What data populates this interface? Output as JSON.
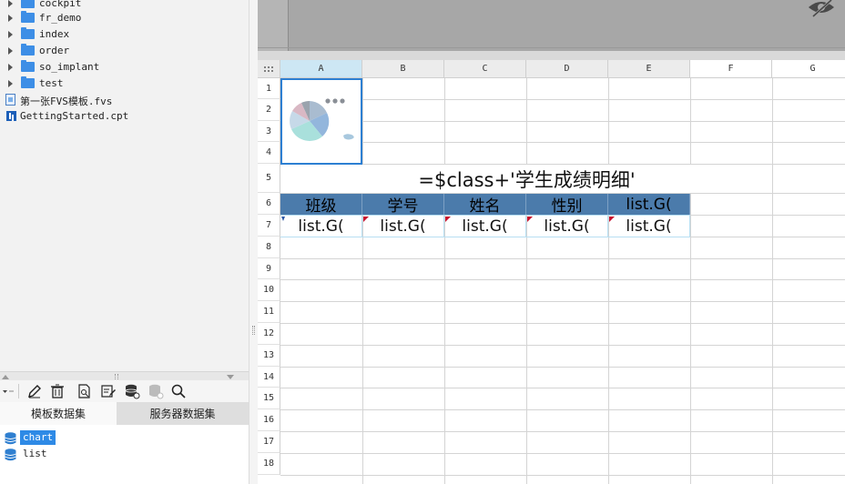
{
  "file_tree": {
    "folders": [
      {
        "name": "cockpit"
      },
      {
        "name": "fr_demo"
      },
      {
        "name": "index"
      },
      {
        "name": "order"
      },
      {
        "name": "so_implant"
      },
      {
        "name": "test"
      }
    ],
    "files": [
      {
        "name": "第一张FVS模板.fvs",
        "icon": "fvs-file-icon"
      },
      {
        "name": "GettingStarted.cpt",
        "icon": "cpt-file-icon"
      }
    ]
  },
  "dataset_toolbar": {
    "icons": [
      "dropdown-arrow-icon",
      "edit-icon",
      "delete-icon",
      "preview-icon",
      "edit-dataset-icon",
      "database-icon",
      "database-disabled-icon",
      "search-icon"
    ]
  },
  "dataset_tabs": {
    "template": "模板数据集",
    "server": "服务器数据集",
    "active": "template"
  },
  "datasets": [
    {
      "name": "chart",
      "selected": true
    },
    {
      "name": "list",
      "selected": false
    }
  ],
  "sheet": {
    "columns": [
      "A",
      "B",
      "C",
      "D",
      "E",
      "F",
      "G"
    ],
    "selected_column": "A",
    "rows": [
      "1",
      "2",
      "3",
      "4",
      "5",
      "6",
      "7",
      "8",
      "9",
      "10",
      "11",
      "12",
      "13",
      "14",
      "15",
      "16",
      "17",
      "18"
    ],
    "title_formula": "=$class+'学生成绩明细'",
    "header_cells": [
      "班级",
      "学号",
      "姓名",
      "性别",
      "list.G("
    ],
    "data_cells": [
      "list.G(",
      "list.G(",
      "list.G(",
      "list.G(",
      "list.G("
    ],
    "chart_cell_content": "pie-chart-icon"
  },
  "colors": {
    "header_fill": "#4b7bab",
    "selection_border": "#2d7fd2",
    "folder": "#3d8ee6",
    "selected_dataset": "#2e8ae6"
  }
}
